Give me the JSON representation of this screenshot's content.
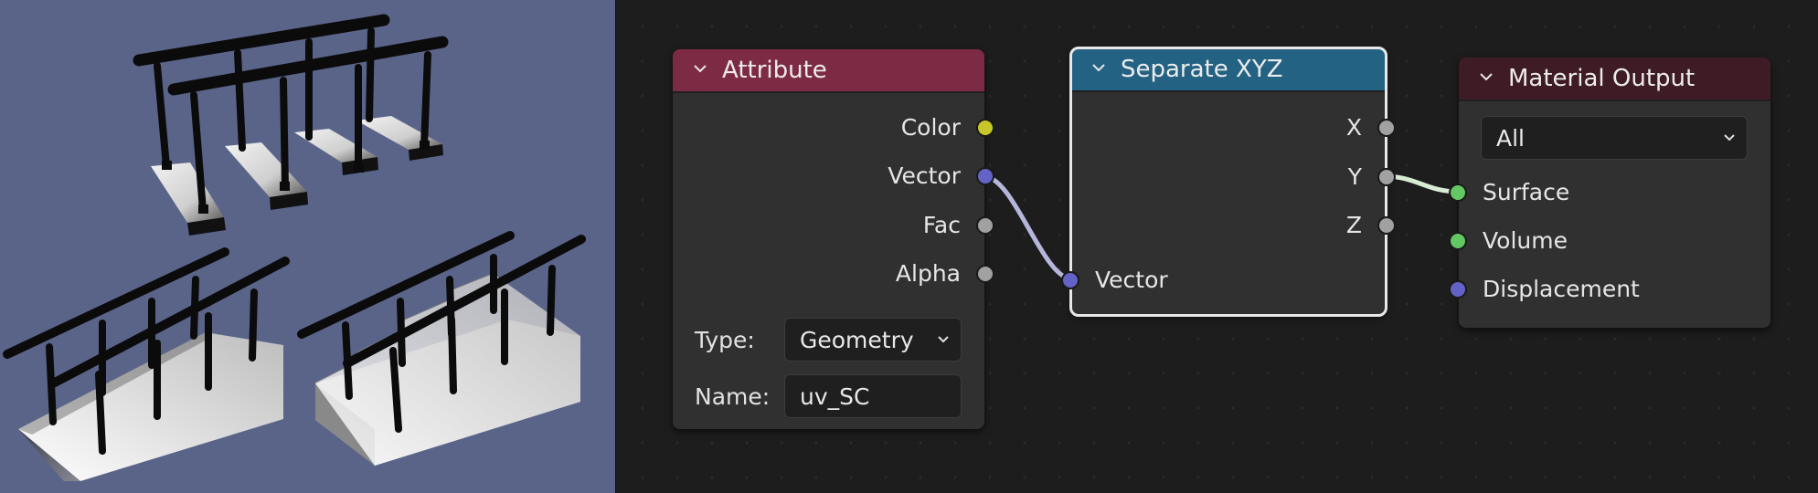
{
  "viewport": {
    "scenes": [
      "railing-on-steps",
      "railing-on-ramp",
      "railing-on-stairs"
    ]
  },
  "nodes": {
    "attribute": {
      "title": "Attribute",
      "header_color": "#7d2b45",
      "outputs": [
        {
          "label": "Color",
          "socket_color": "#c7c729"
        },
        {
          "label": "Vector",
          "socket_color": "#6363c7"
        },
        {
          "label": "Fac",
          "socket_color": "#a1a1a1"
        },
        {
          "label": "Alpha",
          "socket_color": "#a1a1a1"
        }
      ],
      "type_label": "Type:",
      "type_value": "Geometry",
      "name_label": "Name:",
      "name_value": "uv_SC"
    },
    "separate_xyz": {
      "title": "Separate XYZ",
      "header_color": "#246283",
      "outputs": [
        {
          "label": "X",
          "socket_color": "#a1a1a1"
        },
        {
          "label": "Y",
          "socket_color": "#a1a1a1"
        },
        {
          "label": "Z",
          "socket_color": "#a1a1a1"
        }
      ],
      "input": {
        "label": "Vector",
        "socket_color": "#6363c7"
      }
    },
    "material_output": {
      "title": "Material Output",
      "header_color": "#3f1b25",
      "target_value": "All",
      "inputs": [
        {
          "label": "Surface",
          "socket_color": "#63c763"
        },
        {
          "label": "Volume",
          "socket_color": "#63c763"
        },
        {
          "label": "Displacement",
          "socket_color": "#6363c7"
        }
      ]
    }
  },
  "links": [
    {
      "from": "Attribute.Vector",
      "to": "Separate XYZ.Vector"
    },
    {
      "from": "Separate XYZ.Y",
      "to": "Material Output.Surface"
    }
  ]
}
